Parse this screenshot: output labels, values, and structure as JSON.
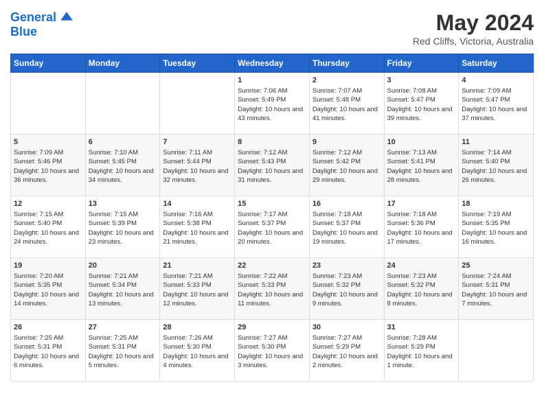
{
  "header": {
    "logo_line1": "General",
    "logo_line2": "Blue",
    "month_year": "May 2024",
    "location": "Red Cliffs, Victoria, Australia"
  },
  "weekdays": [
    "Sunday",
    "Monday",
    "Tuesday",
    "Wednesday",
    "Thursday",
    "Friday",
    "Saturday"
  ],
  "rows": [
    [
      {
        "day": "",
        "sunrise": "",
        "sunset": "",
        "daylight": ""
      },
      {
        "day": "",
        "sunrise": "",
        "sunset": "",
        "daylight": ""
      },
      {
        "day": "",
        "sunrise": "",
        "sunset": "",
        "daylight": ""
      },
      {
        "day": "1",
        "sunrise": "Sunrise: 7:06 AM",
        "sunset": "Sunset: 5:49 PM",
        "daylight": "Daylight: 10 hours and 43 minutes."
      },
      {
        "day": "2",
        "sunrise": "Sunrise: 7:07 AM",
        "sunset": "Sunset: 5:48 PM",
        "daylight": "Daylight: 10 hours and 41 minutes."
      },
      {
        "day": "3",
        "sunrise": "Sunrise: 7:08 AM",
        "sunset": "Sunset: 5:47 PM",
        "daylight": "Daylight: 10 hours and 39 minutes."
      },
      {
        "day": "4",
        "sunrise": "Sunrise: 7:09 AM",
        "sunset": "Sunset: 5:47 PM",
        "daylight": "Daylight: 10 hours and 37 minutes."
      }
    ],
    [
      {
        "day": "5",
        "sunrise": "Sunrise: 7:09 AM",
        "sunset": "Sunset: 5:46 PM",
        "daylight": "Daylight: 10 hours and 36 minutes."
      },
      {
        "day": "6",
        "sunrise": "Sunrise: 7:10 AM",
        "sunset": "Sunset: 5:45 PM",
        "daylight": "Daylight: 10 hours and 34 minutes."
      },
      {
        "day": "7",
        "sunrise": "Sunrise: 7:11 AM",
        "sunset": "Sunset: 5:44 PM",
        "daylight": "Daylight: 10 hours and 32 minutes."
      },
      {
        "day": "8",
        "sunrise": "Sunrise: 7:12 AM",
        "sunset": "Sunset: 5:43 PM",
        "daylight": "Daylight: 10 hours and 31 minutes."
      },
      {
        "day": "9",
        "sunrise": "Sunrise: 7:12 AM",
        "sunset": "Sunset: 5:42 PM",
        "daylight": "Daylight: 10 hours and 29 minutes."
      },
      {
        "day": "10",
        "sunrise": "Sunrise: 7:13 AM",
        "sunset": "Sunset: 5:41 PM",
        "daylight": "Daylight: 10 hours and 28 minutes."
      },
      {
        "day": "11",
        "sunrise": "Sunrise: 7:14 AM",
        "sunset": "Sunset: 5:40 PM",
        "daylight": "Daylight: 10 hours and 26 minutes."
      }
    ],
    [
      {
        "day": "12",
        "sunrise": "Sunrise: 7:15 AM",
        "sunset": "Sunset: 5:40 PM",
        "daylight": "Daylight: 10 hours and 24 minutes."
      },
      {
        "day": "13",
        "sunrise": "Sunrise: 7:15 AM",
        "sunset": "Sunset: 5:39 PM",
        "daylight": "Daylight: 10 hours and 23 minutes."
      },
      {
        "day": "14",
        "sunrise": "Sunrise: 7:16 AM",
        "sunset": "Sunset: 5:38 PM",
        "daylight": "Daylight: 10 hours and 21 minutes."
      },
      {
        "day": "15",
        "sunrise": "Sunrise: 7:17 AM",
        "sunset": "Sunset: 5:37 PM",
        "daylight": "Daylight: 10 hours and 20 minutes."
      },
      {
        "day": "16",
        "sunrise": "Sunrise: 7:18 AM",
        "sunset": "Sunset: 5:37 PM",
        "daylight": "Daylight: 10 hours and 19 minutes."
      },
      {
        "day": "17",
        "sunrise": "Sunrise: 7:18 AM",
        "sunset": "Sunset: 5:36 PM",
        "daylight": "Daylight: 10 hours and 17 minutes."
      },
      {
        "day": "18",
        "sunrise": "Sunrise: 7:19 AM",
        "sunset": "Sunset: 5:35 PM",
        "daylight": "Daylight: 10 hours and 16 minutes."
      }
    ],
    [
      {
        "day": "19",
        "sunrise": "Sunrise: 7:20 AM",
        "sunset": "Sunset: 5:35 PM",
        "daylight": "Daylight: 10 hours and 14 minutes."
      },
      {
        "day": "20",
        "sunrise": "Sunrise: 7:21 AM",
        "sunset": "Sunset: 5:34 PM",
        "daylight": "Daylight: 10 hours and 13 minutes."
      },
      {
        "day": "21",
        "sunrise": "Sunrise: 7:21 AM",
        "sunset": "Sunset: 5:33 PM",
        "daylight": "Daylight: 10 hours and 12 minutes."
      },
      {
        "day": "22",
        "sunrise": "Sunrise: 7:22 AM",
        "sunset": "Sunset: 5:33 PM",
        "daylight": "Daylight: 10 hours and 11 minutes."
      },
      {
        "day": "23",
        "sunrise": "Sunrise: 7:23 AM",
        "sunset": "Sunset: 5:32 PM",
        "daylight": "Daylight: 10 hours and 9 minutes."
      },
      {
        "day": "24",
        "sunrise": "Sunrise: 7:23 AM",
        "sunset": "Sunset: 5:32 PM",
        "daylight": "Daylight: 10 hours and 8 minutes."
      },
      {
        "day": "25",
        "sunrise": "Sunrise: 7:24 AM",
        "sunset": "Sunset: 5:31 PM",
        "daylight": "Daylight: 10 hours and 7 minutes."
      }
    ],
    [
      {
        "day": "26",
        "sunrise": "Sunrise: 7:25 AM",
        "sunset": "Sunset: 5:31 PM",
        "daylight": "Daylight: 10 hours and 6 minutes."
      },
      {
        "day": "27",
        "sunrise": "Sunrise: 7:25 AM",
        "sunset": "Sunset: 5:31 PM",
        "daylight": "Daylight: 10 hours and 5 minutes."
      },
      {
        "day": "28",
        "sunrise": "Sunrise: 7:26 AM",
        "sunset": "Sunset: 5:30 PM",
        "daylight": "Daylight: 10 hours and 4 minutes."
      },
      {
        "day": "29",
        "sunrise": "Sunrise: 7:27 AM",
        "sunset": "Sunset: 5:30 PM",
        "daylight": "Daylight: 10 hours and 3 minutes."
      },
      {
        "day": "30",
        "sunrise": "Sunrise: 7:27 AM",
        "sunset": "Sunset: 5:29 PM",
        "daylight": "Daylight: 10 hours and 2 minutes."
      },
      {
        "day": "31",
        "sunrise": "Sunrise: 7:28 AM",
        "sunset": "Sunset: 5:29 PM",
        "daylight": "Daylight: 10 hours and 1 minute."
      },
      {
        "day": "",
        "sunrise": "",
        "sunset": "",
        "daylight": ""
      }
    ]
  ]
}
